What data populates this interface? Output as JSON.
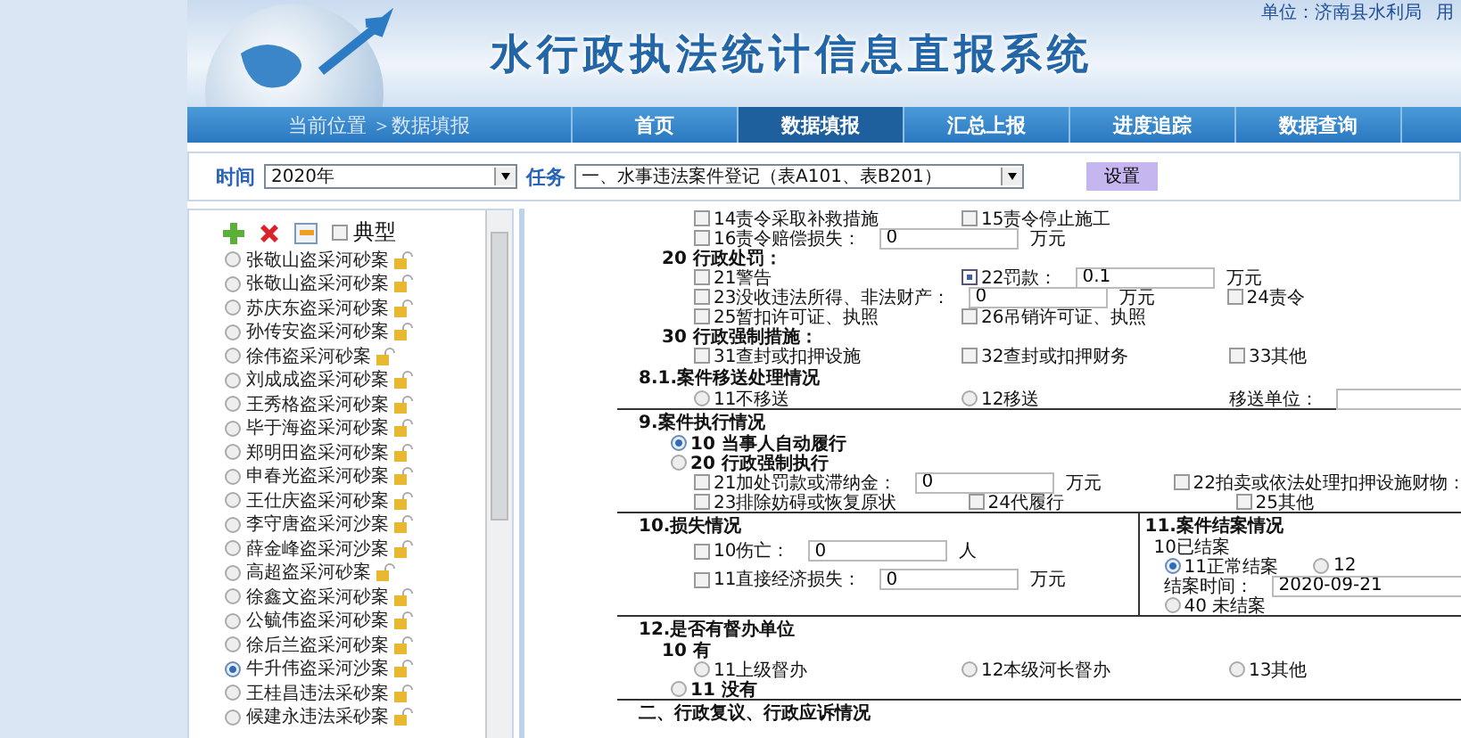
{
  "header": {
    "unit": "单位：济南县水利局",
    "user": "用",
    "title": "水行政执法统计信息直报系统"
  },
  "nav": {
    "breadcrumb": "当前位置 ＞数据填报",
    "tabs": [
      {
        "label": "首页",
        "selected": false
      },
      {
        "label": "数据填报",
        "selected": true
      },
      {
        "label": "汇总上报",
        "selected": false
      },
      {
        "label": "进度追踪",
        "selected": false
      },
      {
        "label": "数据查询",
        "selected": false
      }
    ]
  },
  "filter": {
    "time_label": "时间",
    "time_value": "2020年",
    "task_label": "任务",
    "task_value": "一、水事违法案件登记（表A101、表B201）",
    "button": "设置"
  },
  "case_list": {
    "typical_label": "典型",
    "typical_checked": false,
    "items": [
      {
        "name": "张敬山盗采河砂案",
        "selected": false
      },
      {
        "name": "张敬山盗采河砂案",
        "selected": false
      },
      {
        "name": "苏庆东盗采河砂案",
        "selected": false
      },
      {
        "name": "孙传安盗采河砂案",
        "selected": false
      },
      {
        "name": "徐伟盗采河砂案",
        "selected": false
      },
      {
        "name": "刘成成盗采河砂案",
        "selected": false
      },
      {
        "name": "王秀格盗采河砂案",
        "selected": false
      },
      {
        "name": "毕于海盗采河砂案",
        "selected": false
      },
      {
        "name": "郑明田盗采河砂案",
        "selected": false
      },
      {
        "name": "申春光盗采河砂案",
        "selected": false
      },
      {
        "name": "王仕庆盗采河砂案",
        "selected": false
      },
      {
        "name": "李守唐盗采河沙案",
        "selected": false
      },
      {
        "name": "薛金峰盗采河沙案",
        "selected": false
      },
      {
        "name": "高超盗采河砂案",
        "selected": false
      },
      {
        "name": "徐鑫文盗采河砂案",
        "selected": false
      },
      {
        "name": "公毓伟盗采河砂案",
        "selected": false
      },
      {
        "name": "徐后兰盗采河砂案",
        "selected": false
      },
      {
        "name": "牛升伟盗采河沙案",
        "selected": true
      },
      {
        "name": "王桂昌违法采砂案",
        "selected": false
      },
      {
        "name": "候建永违法采砂案",
        "selected": false
      }
    ]
  },
  "form": {
    "blocks": [
      {
        "columns": [
          {
            "lines": [
              {
                "kind": "options",
                "cells": [
                  {
                    "kind": "checkbox",
                    "label": "14责令采取补救措施",
                    "checked": false
                  },
                  {
                    "kind": "checkbox",
                    "label": "15责令停止施工",
                    "checked": false
                  }
                ]
              },
              {
                "kind": "options",
                "cells": [
                  {
                    "kind": "checkbox",
                    "label": "16责令赔偿损失：",
                    "checked": false,
                    "value": "0",
                    "unit": "万元"
                  }
                ]
              },
              {
                "kind": "group",
                "text": "20 行政处罚："
              },
              {
                "kind": "options",
                "cells": [
                  {
                    "kind": "checkbox",
                    "label": "21警告",
                    "checked": false
                  },
                  {
                    "kind": "checkbox",
                    "label": "22罚款：",
                    "checked": true,
                    "value": "0.1",
                    "unit": "万元"
                  }
                ]
              },
              {
                "kind": "options",
                "cells": [
                  {
                    "kind": "checkbox",
                    "label": "23没收违法所得、非法财产：",
                    "checked": false,
                    "value": "0",
                    "unit": "万元"
                  },
                  {
                    "kind": "checkbox",
                    "label": "24责令",
                    "checked": false
                  }
                ]
              },
              {
                "kind": "options",
                "cells": [
                  {
                    "kind": "checkbox",
                    "label": "25暂扣许可证、执照",
                    "checked": false
                  },
                  {
                    "kind": "checkbox",
                    "label": "26吊销许可证、执照",
                    "checked": false
                  }
                ]
              },
              {
                "kind": "group",
                "text": "30 行政强制措施："
              },
              {
                "kind": "options",
                "cells": [
                  {
                    "kind": "checkbox",
                    "label": "31查封或扣押设施",
                    "checked": false
                  },
                  {
                    "kind": "checkbox",
                    "label": "32查封或扣押财务",
                    "checked": false
                  },
                  {
                    "kind": "checkbox",
                    "label": "33其他",
                    "checked": false
                  }
                ]
              },
              {
                "kind": "section",
                "text": "8.1.案件移送处理情况"
              },
              {
                "kind": "options",
                "cells": [
                  {
                    "kind": "radio",
                    "label": "11不移送",
                    "selected": false
                  },
                  {
                    "kind": "radio",
                    "label": "12移送",
                    "selected": false
                  },
                  {
                    "kind": "field",
                    "label": "移送单位："
                  }
                ]
              }
            ]
          }
        ]
      },
      {
        "columns": [
          {
            "lines": [
              {
                "kind": "section",
                "text": "9.案件执行情况"
              },
              {
                "kind": "choices",
                "cells": [
                  {
                    "kind": "radio",
                    "label": "10 当事人自动履行",
                    "selected": true
                  }
                ]
              },
              {
                "kind": "choices",
                "cells": [
                  {
                    "kind": "radio",
                    "label": "20 行政强制执行",
                    "selected": false
                  }
                ]
              },
              {
                "kind": "options",
                "cells": [
                  {
                    "kind": "checkbox",
                    "label": "21加处罚款或滞纳金：",
                    "checked": false,
                    "value": "0",
                    "unit": "万元"
                  },
                  {
                    "kind": "checkbox",
                    "label": "22拍卖或依法处理扣押设施财物：",
                    "checked": false
                  }
                ]
              },
              {
                "kind": "options",
                "cells": [
                  {
                    "kind": "checkbox",
                    "label": "23排除妨碍或恢复原状",
                    "checked": false
                  },
                  {
                    "kind": "checkbox",
                    "label": "24代履行",
                    "checked": false
                  },
                  {
                    "kind": "checkbox",
                    "label": "25其他",
                    "checked": false
                  }
                ]
              }
            ]
          }
        ]
      },
      {
        "columns": [
          {
            "lines": [
              {
                "kind": "section",
                "text": "10.损失情况"
              },
              {
                "kind": "options",
                "cells": [
                  {
                    "kind": "checkbox",
                    "label": "10伤亡：",
                    "checked": false,
                    "value": "0",
                    "unit": "人"
                  }
                ]
              },
              {
                "kind": "options",
                "cells": [
                  {
                    "kind": "checkbox",
                    "label": "11直接经济损失：",
                    "checked": false,
                    "value": "0",
                    "unit": "万元"
                  }
                ]
              }
            ]
          },
          {
            "lines": [
              {
                "kind": "section",
                "text": "11.案件结案情况"
              },
              {
                "kind": "text",
                "text": "10已结案"
              },
              {
                "kind": "options",
                "cells": [
                  {
                    "kind": "radio",
                    "label": "11正常结案",
                    "selected": true
                  },
                  {
                    "kind": "radio",
                    "label": "12",
                    "selected": false
                  }
                ]
              },
              {
                "kind": "options",
                "cells": [
                  {
                    "kind": "field",
                    "label": "结案时间：",
                    "value": "2020-09-21"
                  }
                ]
              },
              {
                "kind": "options",
                "cells": [
                  {
                    "kind": "radio",
                    "label": "40 未结案",
                    "selected": false
                  }
                ]
              }
            ]
          }
        ]
      },
      {
        "columns": [
          {
            "lines": [
              {
                "kind": "section",
                "text": "12.是否有督办单位"
              },
              {
                "kind": "group",
                "text": "10 有"
              },
              {
                "kind": "options",
                "cells": [
                  {
                    "kind": "radio",
                    "label": "11上级督办",
                    "selected": false
                  },
                  {
                    "kind": "radio",
                    "label": "12本级河长督办",
                    "selected": false
                  },
                  {
                    "kind": "radio",
                    "label": "13其他",
                    "selected": false
                  }
                ]
              },
              {
                "kind": "choices",
                "cells": [
                  {
                    "kind": "radio",
                    "label": "11 没有",
                    "selected": false
                  }
                ]
              }
            ]
          }
        ]
      },
      {
        "columns": [
          {
            "lines": [
              {
                "kind": "section",
                "text": "二、行政复议、行政应诉情况"
              }
            ]
          }
        ]
      }
    ]
  }
}
